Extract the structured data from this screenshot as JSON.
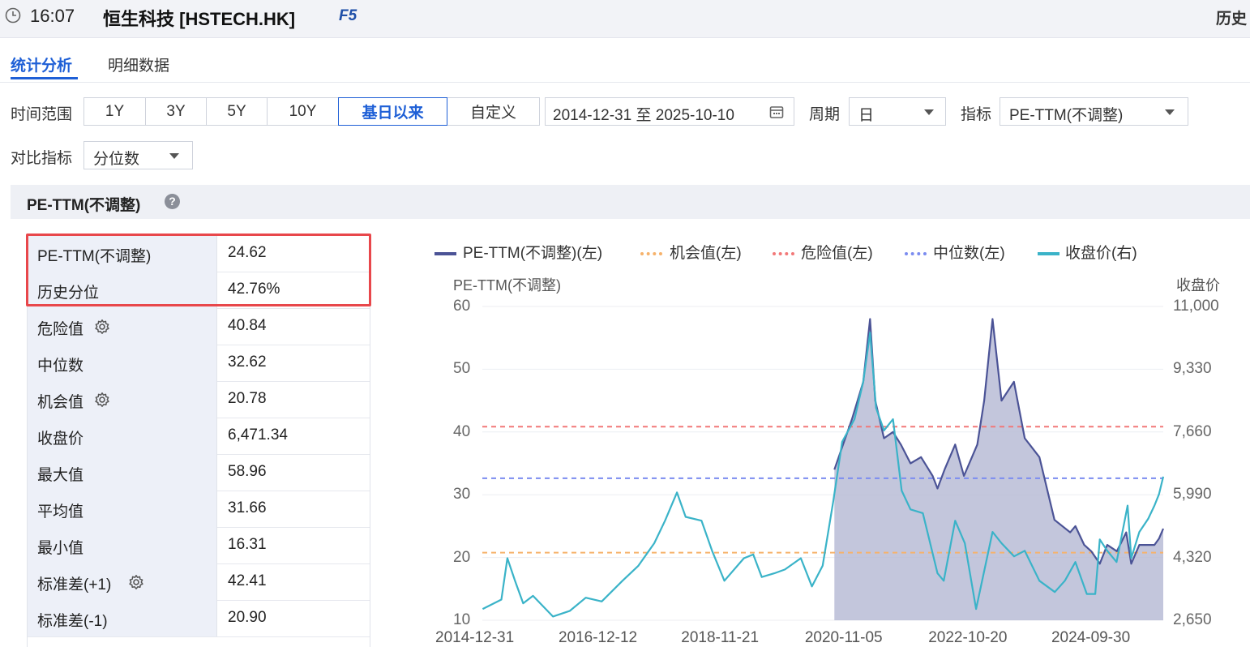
{
  "header": {
    "time": "16:07",
    "title": "恒生科技 [HSTECH.HK]",
    "badge": "F5",
    "history_link": "历史"
  },
  "tabs": [
    {
      "label": "统计分析",
      "active": true
    },
    {
      "label": "明细数据",
      "active": false
    }
  ],
  "filters": {
    "range_label": "时间范围",
    "ranges": [
      "1Y",
      "3Y",
      "5Y",
      "10Y",
      "基日以来",
      "自定义"
    ],
    "active_range": "基日以来",
    "date_range": "2014-12-31 至 2025-10-10",
    "period_label": "周期",
    "period_value": "日",
    "indicator_label": "指标",
    "indicator_value": "PE-TTM(不调整)",
    "compare_label": "对比指标",
    "compare_value": "分位数"
  },
  "section": {
    "title": "PE-TTM(不调整)",
    "help_icon": "question-circle-icon"
  },
  "stats": [
    {
      "name": "PE-TTM(不调整)",
      "value": "24.62",
      "gear": false,
      "highlight": true
    },
    {
      "name": "历史分位",
      "value": "42.76%",
      "gear": false,
      "highlight": true
    },
    {
      "name": "危险值",
      "value": "40.84",
      "gear": true
    },
    {
      "name": "中位数",
      "value": "32.62",
      "gear": false
    },
    {
      "name": "机会值",
      "value": "20.78",
      "gear": true
    },
    {
      "name": "收盘价",
      "value": "6,471.34",
      "gear": false
    },
    {
      "name": "最大值",
      "value": "58.96",
      "gear": false
    },
    {
      "name": "平均值",
      "value": "31.66",
      "gear": false
    },
    {
      "name": "最小值",
      "value": "16.31",
      "gear": false
    },
    {
      "name": "标准差(+1)",
      "value": "42.41",
      "gear": true
    },
    {
      "name": "标准差(-1)",
      "value": "20.90",
      "gear": false
    }
  ],
  "colors": {
    "accent": "#1e5fd6",
    "highlight": "#e8474b",
    "pe_line": "#4b5396",
    "pe_fill": "#b8bcd6",
    "close_line": "#3ab3c8",
    "opportunity": "#f6b26b",
    "danger": "#f27878",
    "median": "#7b8cf0"
  },
  "chart_data": {
    "type": "line",
    "legend": [
      "PE-TTM(不调整)(左)",
      "机会值(左)",
      "危险值(左)",
      "中位数(左)",
      "收盘价(右)"
    ],
    "left_axis_title": "PE-TTM(不调整)",
    "right_axis_title": "收盘价",
    "left_ticks": [
      "60",
      "50",
      "40",
      "30",
      "20",
      "10"
    ],
    "right_ticks": [
      "11,000",
      "9,330",
      "7,660",
      "5,990",
      "4,320",
      "2,650"
    ],
    "x_ticks": [
      "2014-12-31",
      "2016-12-12",
      "2018-11-21",
      "2020-11-05",
      "2022-10-20",
      "2024-09-30"
    ],
    "ylim_left": [
      10,
      60
    ],
    "ylim_right": [
      2650,
      11000
    ],
    "lines": {
      "danger": 40.84,
      "median": 32.62,
      "opportunity": 20.78
    },
    "pe_series": {
      "name": "PE-TTM(不调整)(左)",
      "x": [
        "2020-07-27",
        "2020-09-15",
        "2020-11-05",
        "2021-01-10",
        "2021-02-18",
        "2021-03-20",
        "2021-05-10",
        "2021-07-01",
        "2021-08-15",
        "2021-10-10",
        "2021-12-10",
        "2022-02-15",
        "2022-03-15",
        "2022-04-25",
        "2022-06-25",
        "2022-08-15",
        "2022-10-31",
        "2022-12-10",
        "2023-01-27",
        "2023-03-20",
        "2023-05-31",
        "2023-08-01",
        "2023-10-25",
        "2024-01-20",
        "2024-04-20",
        "2024-05-20",
        "2024-07-10",
        "2024-08-20",
        "2024-10-08",
        "2024-11-20",
        "2025-01-15",
        "2025-03-10",
        "2025-04-08",
        "2025-05-25",
        "2025-07-15",
        "2025-08-20",
        "2025-09-15",
        "2025-10-10"
      ],
      "values": [
        34,
        38,
        42,
        48,
        58,
        45,
        39,
        40,
        38,
        35,
        36,
        33,
        31,
        34,
        38,
        33,
        38,
        45,
        58,
        45,
        48,
        39,
        36,
        26,
        24,
        25,
        22,
        21,
        19,
        22,
        21,
        24,
        19,
        22,
        22,
        22,
        23,
        24.6
      ]
    },
    "close_series": {
      "name": "收盘价(右)",
      "x": [
        "2015-01-02",
        "2015-04-20",
        "2015-05-25",
        "2015-07-08",
        "2015-08-24",
        "2015-10-20",
        "2016-02-12",
        "2016-05-20",
        "2016-08-20",
        "2016-11-20",
        "2017-03-20",
        "2017-06-20",
        "2017-09-20",
        "2017-11-21",
        "2018-01-29",
        "2018-03-20",
        "2018-06-20",
        "2018-08-20",
        "2018-10-30",
        "2019-02-20",
        "2019-04-15",
        "2019-06-03",
        "2019-08-15",
        "2019-10-15",
        "2020-01-15",
        "2020-03-19",
        "2020-05-20",
        "2020-07-20",
        "2020-09-10",
        "2020-11-20",
        "2021-01-10",
        "2021-02-18",
        "2021-03-25",
        "2021-05-10",
        "2021-07-01",
        "2021-08-20",
        "2021-10-10",
        "2021-12-20",
        "2022-03-15",
        "2022-04-20",
        "2022-06-25",
        "2022-08-20",
        "2022-10-24",
        "2023-01-27",
        "2023-03-20",
        "2023-06-01",
        "2023-08-01",
        "2023-10-25",
        "2024-01-22",
        "2024-03-20",
        "2024-05-20",
        "2024-07-25",
        "2024-09-12",
        "2024-10-08",
        "2024-11-20",
        "2025-01-13",
        "2025-03-18",
        "2025-04-08",
        "2025-05-25",
        "2025-07-15",
        "2025-08-20",
        "2025-09-15",
        "2025-10-10"
      ],
      "values": [
        2950,
        3200,
        4300,
        3700,
        3100,
        3300,
        2750,
        2900,
        3250,
        3150,
        3700,
        4100,
        4700,
        5300,
        6050,
        5400,
        5300,
        4500,
        3700,
        4300,
        4400,
        3800,
        3900,
        4000,
        4300,
        3550,
        4100,
        5800,
        7400,
        8000,
        9000,
        10300,
        8300,
        7700,
        8000,
        6100,
        5600,
        5500,
        3900,
        3700,
        5300,
        4700,
        2950,
        5000,
        4700,
        4350,
        4500,
        3700,
        3400,
        3700,
        4200,
        3350,
        3350,
        4800,
        4500,
        4200,
        5700,
        4300,
        5000,
        5350,
        5700,
        6000,
        6471
      ]
    }
  }
}
